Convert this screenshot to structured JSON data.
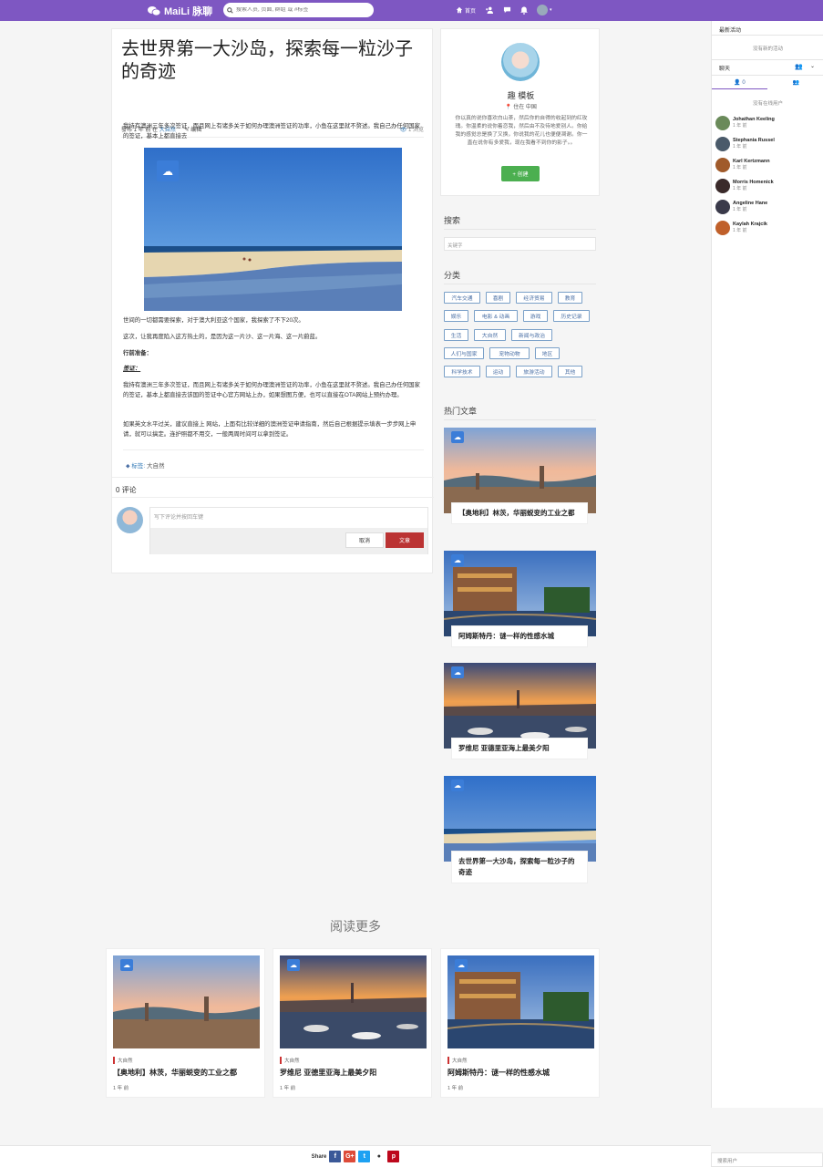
{
  "topbar": {
    "brand": "MaiLi 脉聊",
    "search_placeholder": "搜索人员, 页面, 群组 或 #标签",
    "home_label": "首页",
    "accent": "#7e57c2"
  },
  "article": {
    "title": "去世界第一大沙岛，探索每一粒沙子的奇迹",
    "meta_prefix": "發布 1 年 前 在",
    "meta_category": "大自然",
    "edit_label": "编辑",
    "views": "1 浏览",
    "p1": "我持有澳洲三年多次签证，而且网上有诸多关于如何办理澳洲签证的功率，小鱼在这里就不赘述。我自己办任何国家的签证，基本上都直接去",
    "p2": "世间的一切都需要探索，对于澳大利亚这个国家，我探索了不下20次。",
    "p3": "这次，让我再度陷入这方热土的，是因为这一片沙、这一片海、这一片蔚蓝。",
    "h_prep": "行前准备：",
    "h_visa": "签证：",
    "p4": "我持有澳洲三年多次签证，而且网上有诸多关于如何办理澳洲签证的功率，小鱼在这里就不赘述。我自己办任何国家的签证，基本上都直接去该国的签证中心官方网站上办，如果想图方便，也可以直接在OTA网站上预约办理。",
    "p5": "如果英文水平过关，建议直接上  网站，上面有比较详细的澳洲签证申请指南，然后自己根据提示填表一步步网上申请，就可以搞定。连护照都不用交，一般两周时间可以拿到签证。",
    "tags_label": "标签:",
    "tag": "大自然",
    "comments_count": "0 评论",
    "comment_placeholder": "写下评论并按回车键",
    "cancel_label": "取消",
    "submit_label": "文章"
  },
  "profile": {
    "name": "趣 模板",
    "location": "住在 中国",
    "bio": "你以真的说你喜欢白山茶，然后你的自得的收起到的红玫瑰。你温柔的说你着恋我，然后由不及待地爱别人。你给我的感觉总是换了又换，你说我的花儿也便便凋谢。你一直在说你有多爱我，现在我看不到你的影子。。",
    "create_label": "+ 创建"
  },
  "sidebar": {
    "search_title": "搜索",
    "search_placeholder": "关键字",
    "categories_title": "分类",
    "categories": [
      "汽车交通",
      "喜剧",
      "经济贸易",
      "教育",
      "娱乐",
      "电影 & 动画",
      "游戏",
      "历史记录",
      "生活",
      "大自然",
      "新闻与政治",
      "人们与国家",
      "宠物动物",
      "地区",
      "科学技术",
      "运动",
      "旅游活动",
      "其他"
    ],
    "hot_title": "热门文章",
    "hot": [
      {
        "title": "【奥地利】林茨，华丽蜕变的工业之都"
      },
      {
        "title": "阿姆斯特丹：谜一样的性感水城"
      },
      {
        "title": "罗维尼 亚德里亚海上最美夕阳"
      },
      {
        "title": "去世界第一大沙岛，探索每一粒沙子的奇迹"
      }
    ]
  },
  "more": {
    "title": "阅读更多",
    "items": [
      {
        "cat": "大自然",
        "title": "【奥地利】林茨，华丽蜕变的工业之都",
        "time": "1 年 前"
      },
      {
        "cat": "大自然",
        "title": "罗维尼 亚德里亚海上最美夕阳",
        "time": "1 年 前"
      },
      {
        "cat": "大自然",
        "title": "阿姆斯特丹：谜一样的性感水城",
        "time": "1 年 前"
      }
    ]
  },
  "right": {
    "activity_title": "最新活动",
    "no_activity": "没有新的活动",
    "chat_title": "聊天",
    "online_count": "0",
    "no_online": "没有在线用户",
    "users": [
      {
        "name": "Johathan Keeling",
        "time": "1 年 前"
      },
      {
        "name": "Stephania Russel",
        "time": "1 年 前"
      },
      {
        "name": "Karl Kertzmann",
        "time": "1 年 前"
      },
      {
        "name": "Morris Homenick",
        "time": "1 年 前"
      },
      {
        "name": "Angeline Hane",
        "time": "1 年 前"
      },
      {
        "name": "Kaylah Krajcik",
        "time": "1 年 前"
      }
    ],
    "find_placeholder": "搜索用户"
  },
  "share": {
    "label": "Share"
  }
}
